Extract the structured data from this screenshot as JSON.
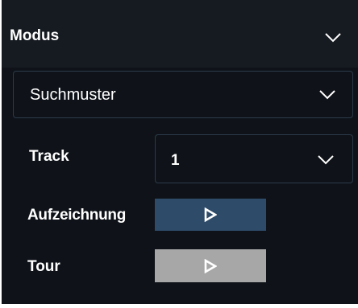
{
  "panel": {
    "header": {
      "title": "Modus",
      "icon": "chevron-down-icon"
    },
    "mode_select": {
      "value": "Suchmuster",
      "icon": "chevron-down-icon"
    },
    "track": {
      "label": "Track",
      "value": "1",
      "icon": "chevron-down-icon"
    },
    "recording": {
      "label": "Aufzeichnung",
      "icon": "play-icon",
      "color": "#2e4b69"
    },
    "tour": {
      "label": "Tour",
      "icon": "play-icon",
      "color": "#a7a7a7"
    }
  }
}
